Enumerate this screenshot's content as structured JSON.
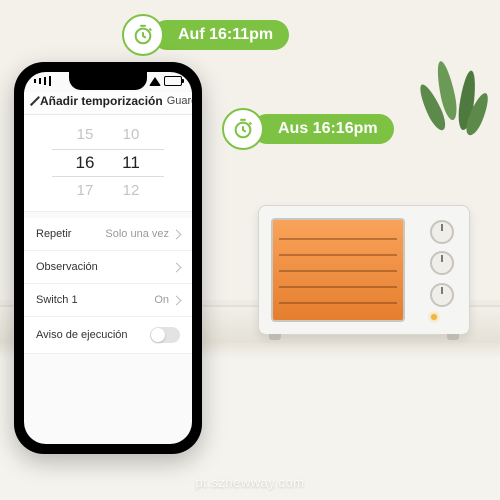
{
  "notifications": {
    "on": {
      "label": "Auf 16:11pm"
    },
    "off": {
      "label": "Aus 16:16pm"
    }
  },
  "phone": {
    "nav": {
      "title": "Añadir temporización",
      "save": "Guardar"
    },
    "timepicker": {
      "prev_hour": "15",
      "prev_min": "10",
      "sel_hour": "16",
      "sel_min": "11",
      "next_hour": "17",
      "next_min": "12"
    },
    "rows": {
      "repeat": {
        "label": "Repetir",
        "value": "Solo una vez"
      },
      "observation": {
        "label": "Observación",
        "value": ""
      },
      "switch1": {
        "label": "Switch 1",
        "value": "On"
      },
      "exec_notice": {
        "label": "Aviso de ejecución"
      }
    }
  },
  "watermark": "pt.sznewway.com",
  "colors": {
    "accent": "#7dc243"
  }
}
